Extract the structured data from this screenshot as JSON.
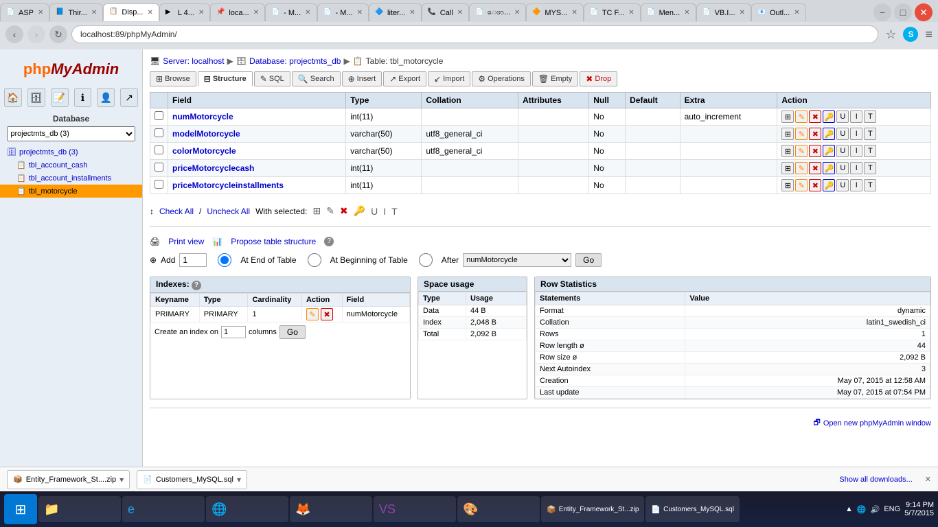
{
  "browser": {
    "url": "localhost:89/phpMyAdmin/",
    "tabs": [
      {
        "label": "ASP",
        "favicon": "📄",
        "active": false
      },
      {
        "label": "Thir...",
        "favicon": "📘",
        "active": false
      },
      {
        "label": "Disp...",
        "favicon": "📋",
        "active": true
      },
      {
        "label": "L 4...",
        "favicon": "▶",
        "active": false
      },
      {
        "label": "loca...",
        "favicon": "📌",
        "active": false
      },
      {
        "label": "- M...",
        "favicon": "📄",
        "active": false
      },
      {
        "label": "- M...",
        "favicon": "📄",
        "active": false
      },
      {
        "label": "liter...",
        "favicon": "🔷",
        "active": false
      },
      {
        "label": "Call",
        "favicon": "📞",
        "active": false
      },
      {
        "label": "ေဖာ...",
        "favicon": "📄",
        "active": false
      },
      {
        "label": "MYS...",
        "favicon": "🔶",
        "active": false
      },
      {
        "label": "TC F...",
        "favicon": "📄",
        "active": false
      },
      {
        "label": "Men...",
        "favicon": "📄",
        "active": false
      },
      {
        "label": "VB.I...",
        "favicon": "📄",
        "active": false
      },
      {
        "label": "Outl...",
        "favicon": "📧",
        "active": false
      }
    ]
  },
  "breadcrumb": {
    "server_label": "Server: localhost",
    "server_sep": "▶",
    "db_label": "Database: projectmts_db",
    "db_sep": "▶",
    "table_label": "Table: tbl_motorcycle"
  },
  "toolbar": {
    "buttons": [
      {
        "label": "Browse",
        "icon": "⊞",
        "active": false
      },
      {
        "label": "Structure",
        "icon": "⊟",
        "active": true
      },
      {
        "label": "SQL",
        "icon": "✎",
        "active": false
      },
      {
        "label": "Search",
        "icon": "🔍",
        "active": false
      },
      {
        "label": "Insert",
        "icon": "⊕",
        "active": false
      },
      {
        "label": "Export",
        "icon": "↗",
        "active": false
      },
      {
        "label": "Import",
        "icon": "↙",
        "active": false
      },
      {
        "label": "Operations",
        "icon": "⚙",
        "active": false
      },
      {
        "label": "Empty",
        "icon": "🗑",
        "active": false
      },
      {
        "label": "Drop",
        "icon": "✖",
        "active": false
      }
    ]
  },
  "fields_table": {
    "headers": [
      "",
      "Field",
      "Type",
      "Collation",
      "Attributes",
      "Null",
      "Default",
      "Extra",
      "Action"
    ],
    "rows": [
      {
        "field": "numMotorcycle",
        "type": "int(11)",
        "collation": "",
        "attributes": "",
        "null": "No",
        "default": "",
        "extra": "auto_increment"
      },
      {
        "field": "modelMotorcycle",
        "type": "varchar(50)",
        "collation": "utf8_general_ci",
        "attributes": "",
        "null": "No",
        "default": "",
        "extra": ""
      },
      {
        "field": "colorMotorcycle",
        "type": "varchar(50)",
        "collation": "utf8_general_ci",
        "attributes": "",
        "null": "No",
        "default": "",
        "extra": ""
      },
      {
        "field": "priceMotorcyclecash",
        "type": "int(11)",
        "collation": "",
        "attributes": "",
        "null": "No",
        "default": "",
        "extra": ""
      },
      {
        "field": "priceMotorcycleinstallments",
        "type": "int(11)",
        "collation": "",
        "attributes": "",
        "null": "No",
        "default": "",
        "extra": ""
      }
    ]
  },
  "check_all_label": "Check All",
  "uncheck_all_label": "Uncheck All",
  "with_selected_label": "With selected:",
  "print_view_label": "Print view",
  "propose_table_structure_label": "Propose table structure",
  "add_label": "Add",
  "add_field_count": "1",
  "add_field_option_at_end": "At End of Table",
  "add_field_option_at_beginning": "At Beginning of Table",
  "add_field_option_after": "After",
  "after_field_select_value": "numMotorcycle",
  "go_btn_label": "Go",
  "indexes": {
    "title": "Indexes:",
    "headers": [
      "Keyname",
      "Type",
      "Cardinality",
      "Action",
      "Field"
    ],
    "rows": [
      {
        "keyname": "PRIMARY",
        "type": "PRIMARY",
        "cardinality": "1",
        "field": "numMotorcycle"
      }
    ],
    "create_label": "Create an index on",
    "create_columns_label": "columns",
    "create_input": "1",
    "go_label": "Go"
  },
  "space_usage": {
    "title": "Space usage",
    "headers": [
      "Type",
      "Usage"
    ],
    "rows": [
      {
        "type": "Data",
        "usage": "44 B"
      },
      {
        "type": "Index",
        "usage": "2,048 B"
      },
      {
        "type": "Total",
        "usage": "2,092 B"
      }
    ]
  },
  "row_statistics": {
    "title": "Row Statistics",
    "headers": [
      "Statements",
      "Value"
    ],
    "rows": [
      {
        "statement": "Format",
        "value": "dynamic"
      },
      {
        "statement": "Collation",
        "value": "latin1_swedish_ci"
      },
      {
        "statement": "Rows",
        "value": "1"
      },
      {
        "statement": "Row length ø",
        "value": "44"
      },
      {
        "statement": "Row size ø",
        "value": "2,092 B"
      },
      {
        "statement": "Next Autoindex",
        "value": "3"
      },
      {
        "statement": "Creation",
        "value": "May 07, 2015 at 12:58 AM"
      },
      {
        "statement": "Last update",
        "value": "May 07, 2015 at 07:54 PM"
      }
    ]
  },
  "open_window_label": "Open new phpMyAdmin window",
  "sidebar": {
    "logo_php": "php",
    "logo_myadmin": "MyAdmin",
    "db_label": "Database",
    "db_select": "projectmts_db (3)",
    "tree": {
      "db_name": "projectmts_db (3)",
      "items": [
        {
          "label": "tbl_account_cash",
          "active": false
        },
        {
          "label": "tbl_account_installments",
          "active": false
        },
        {
          "label": "tbl_motorcycle",
          "active": true
        }
      ]
    }
  },
  "downloads": {
    "items": [
      {
        "label": "Entity_Framework_St....zip"
      },
      {
        "label": "Customers_MySQL.sql"
      }
    ],
    "show_all_label": "Show all downloads...",
    "close_label": "✕"
  },
  "taskbar": {
    "start_icon": "⊞",
    "buttons": [
      {
        "label": "Entity_Framework_St...zip",
        "icon": "📦"
      },
      {
        "label": "Customers_MySQL.sql",
        "icon": "📄"
      }
    ],
    "system_tray": {
      "lang": "ENG",
      "time": "9:14 PM",
      "date": "5/7/2015"
    }
  }
}
